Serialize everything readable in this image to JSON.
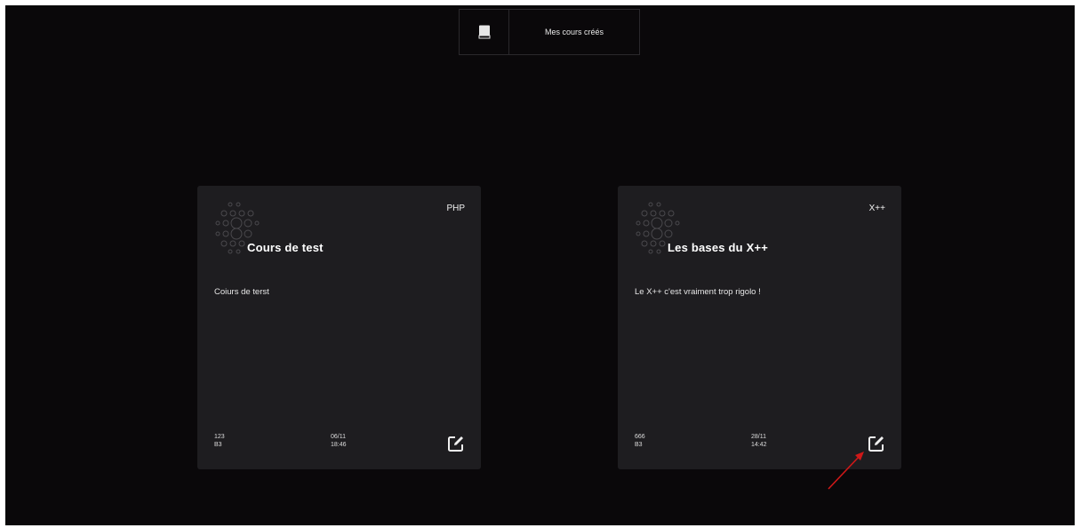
{
  "header": {
    "tab_label": "Mes cours créés",
    "tab_icon": "book-icon"
  },
  "courses": [
    {
      "language": "PHP",
      "title": "Cours de test",
      "description": "Coiurs de terst",
      "code": "123",
      "level": "B3",
      "date": "06/11",
      "time": "18:46",
      "edit_icon": "edit-icon"
    },
    {
      "language": "X++",
      "title": "Les bases du X++",
      "description": "Le X++ c'est vraiment trop rigolo !",
      "code": "666",
      "level": "B3",
      "date": "28/11",
      "time": "14:42",
      "edit_icon": "edit-icon"
    }
  ],
  "colors": {
    "background": "#0a080a",
    "card": "#1e1d20",
    "annotation_arrow": "#d01818"
  }
}
